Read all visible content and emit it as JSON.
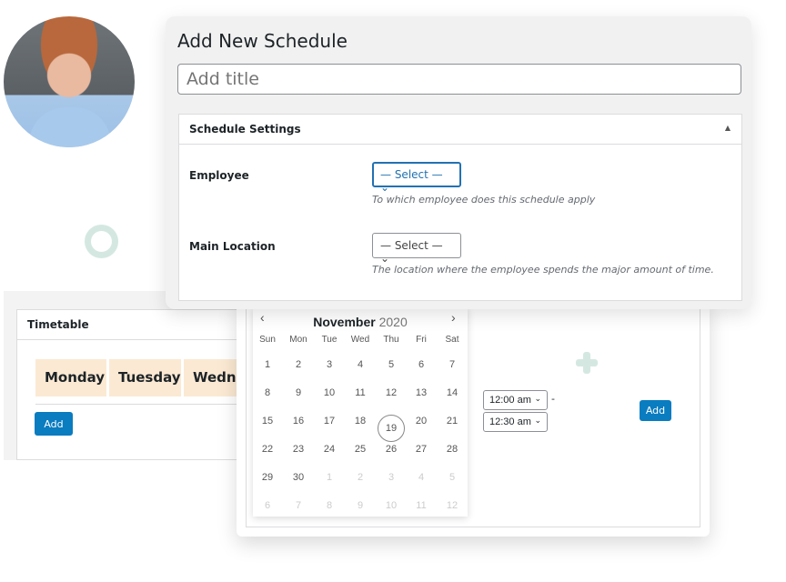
{
  "colors": {
    "accent": "#0a7cc0",
    "focus": "#2271b1",
    "day_header_bg": "#fbe9d3",
    "decor": "#d4e8e1"
  },
  "dialog": {
    "title": "Add New Schedule",
    "title_placeholder": "Add title",
    "settings": {
      "header": "Schedule Settings",
      "collapse_icon": "triangle-up-icon",
      "employee": {
        "label": "Employee",
        "value": "— Select —",
        "help": "To which employee does this schedule apply"
      },
      "location": {
        "label": "Main Location",
        "value": "— Select —",
        "help": "The location where the employee spends the major amount of time."
      }
    }
  },
  "timetable": {
    "title": "Timetable",
    "days": [
      "Monday",
      "Tuesday",
      "Wedne"
    ],
    "add_label": "Add"
  },
  "calendar": {
    "month": "November",
    "year": "2020",
    "weekdays": [
      "Sun",
      "Mon",
      "Tue",
      "Wed",
      "Thu",
      "Fri",
      "Sat"
    ],
    "today": "19",
    "weeks": [
      [
        "1",
        "2",
        "3",
        "4",
        "5",
        "6",
        "7"
      ],
      [
        "8",
        "9",
        "10",
        "11",
        "12",
        "13",
        "14"
      ],
      [
        "15",
        "16",
        "17",
        "18",
        "19",
        "20",
        "21"
      ],
      [
        "22",
        "23",
        "24",
        "25",
        "26",
        "27",
        "28"
      ],
      [
        "29",
        "30",
        "1",
        "2",
        "3",
        "4",
        "5"
      ],
      [
        "6",
        "7",
        "8",
        "9",
        "10",
        "11",
        "12"
      ]
    ]
  },
  "time": {
    "start": "12:00 am",
    "end": "12:30 am",
    "separator": "-",
    "add_label": "Add"
  }
}
